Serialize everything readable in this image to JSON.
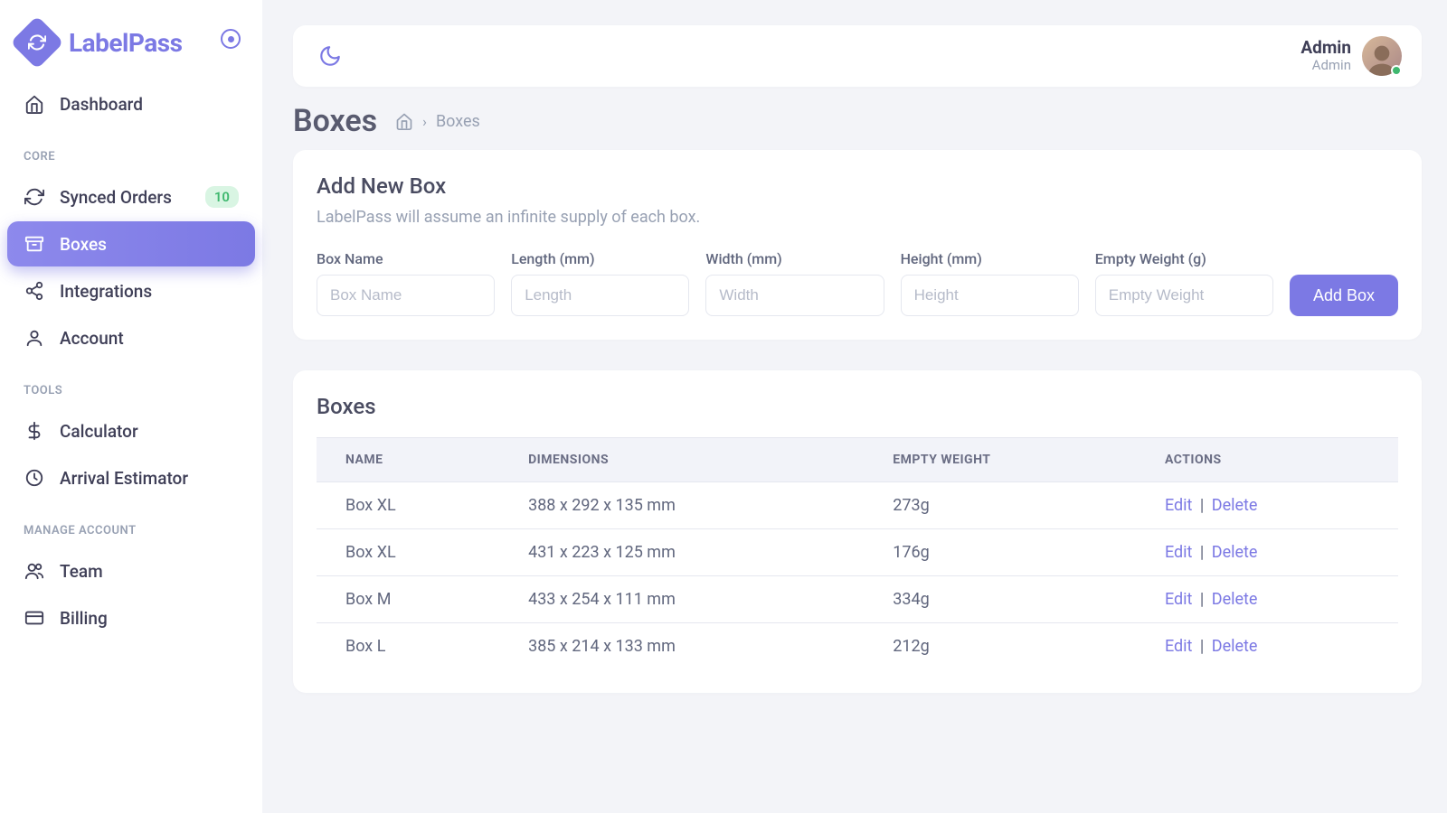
{
  "brand": {
    "name": "LabelPass"
  },
  "sidebar": {
    "top_item": {
      "label": "Dashboard"
    },
    "sections": [
      {
        "title": "CORE",
        "items": [
          {
            "label": "Synced Orders",
            "badge": "10"
          },
          {
            "label": "Boxes"
          },
          {
            "label": "Integrations"
          },
          {
            "label": "Account"
          }
        ]
      },
      {
        "title": "TOOLS",
        "items": [
          {
            "label": "Calculator"
          },
          {
            "label": "Arrival Estimator"
          }
        ]
      },
      {
        "title": "MANAGE ACCOUNT",
        "items": [
          {
            "label": "Team"
          },
          {
            "label": "Billing"
          }
        ]
      }
    ]
  },
  "user": {
    "name": "Admin",
    "role": "Admin"
  },
  "page": {
    "title": "Boxes",
    "breadcrumb_current": "Boxes"
  },
  "add_box": {
    "title": "Add New Box",
    "subtitle": "LabelPass will assume an infinite supply of each box.",
    "fields": {
      "name": {
        "label": "Box Name",
        "placeholder": "Box Name"
      },
      "length": {
        "label": "Length (mm)",
        "placeholder": "Length"
      },
      "width": {
        "label": "Width (mm)",
        "placeholder": "Width"
      },
      "height": {
        "label": "Height (mm)",
        "placeholder": "Height"
      },
      "weight": {
        "label": "Empty Weight (g)",
        "placeholder": "Empty Weight"
      }
    },
    "submit_label": "Add Box"
  },
  "boxes": {
    "title": "Boxes",
    "headers": {
      "name": "NAME",
      "dimensions": "DIMENSIONS",
      "weight": "EMPTY WEIGHT",
      "actions": "ACTIONS"
    },
    "action_labels": {
      "edit": "Edit",
      "delete": "Delete",
      "sep": "|"
    },
    "rows": [
      {
        "name": "Box XL",
        "dimensions": "388 x 292 x 135 mm",
        "weight": "273g"
      },
      {
        "name": "Box XL",
        "dimensions": "431 x 223 x 125 mm",
        "weight": "176g"
      },
      {
        "name": "Box M",
        "dimensions": "433 x 254 x 111 mm",
        "weight": "334g"
      },
      {
        "name": "Box L",
        "dimensions": "385 x 214 x 133 mm",
        "weight": "212g"
      }
    ]
  }
}
